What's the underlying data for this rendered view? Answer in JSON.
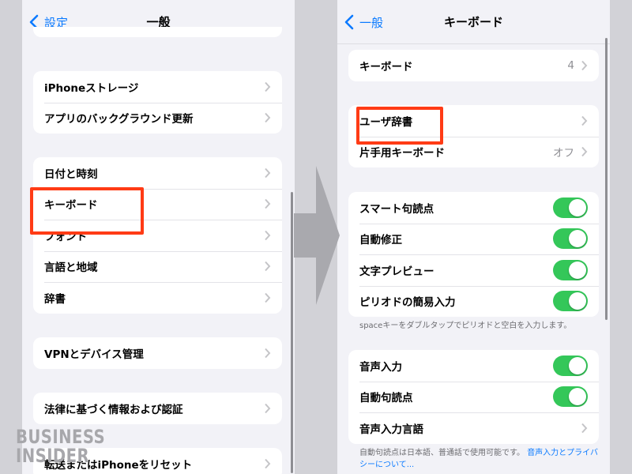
{
  "left": {
    "back_label": "設定",
    "title": "一般",
    "groups": [
      {
        "rows": [
          {
            "label": "iPhoneストレージ"
          },
          {
            "label": "アプリのバックグラウンド更新"
          }
        ]
      },
      {
        "rows": [
          {
            "label": "日付と時刻"
          },
          {
            "label": "キーボード"
          },
          {
            "label": "フォント"
          },
          {
            "label": "言語と地域"
          },
          {
            "label": "辞書"
          }
        ]
      },
      {
        "rows": [
          {
            "label": "VPNとデバイス管理"
          }
        ]
      },
      {
        "rows": [
          {
            "label": "法律に基づく情報および認証"
          }
        ]
      },
      {
        "rows": [
          {
            "label": "転送またはiPhoneをリセット"
          }
        ]
      }
    ]
  },
  "right": {
    "back_label": "一般",
    "title": "キーボード",
    "groups": [
      {
        "rows": [
          {
            "label": "キーボード",
            "value": "4"
          }
        ]
      },
      {
        "rows": [
          {
            "label": "ユーザ辞書"
          },
          {
            "label": "片手用キーボード",
            "value": "オフ"
          }
        ]
      },
      {
        "rows": [
          {
            "label": "スマート句読点",
            "toggle": true
          },
          {
            "label": "自動修正",
            "toggle": true
          },
          {
            "label": "文字プレビュー",
            "toggle": true
          },
          {
            "label": "ピリオドの簡易入力",
            "toggle": true
          }
        ]
      },
      {
        "rows": [
          {
            "label": "音声入力",
            "toggle": true
          },
          {
            "label": "自動句読点",
            "toggle": true
          },
          {
            "label": "音声入力言語"
          }
        ]
      }
    ],
    "footnote_period": "spaceキーをダブルタップでピリオドと空白を入力します。",
    "footnote_dictation": "自動句読点は日本語、普通話で使用可能です。",
    "footnote_link": "音声入力とプライバシーについて..."
  },
  "watermark": {
    "line1": "BUSINESS",
    "line2": "INSIDER"
  },
  "colors": {
    "accent": "#0a7aff",
    "toggle_on": "#34c759",
    "highlight": "#ff3b15",
    "background": "#f2f2f7"
  }
}
